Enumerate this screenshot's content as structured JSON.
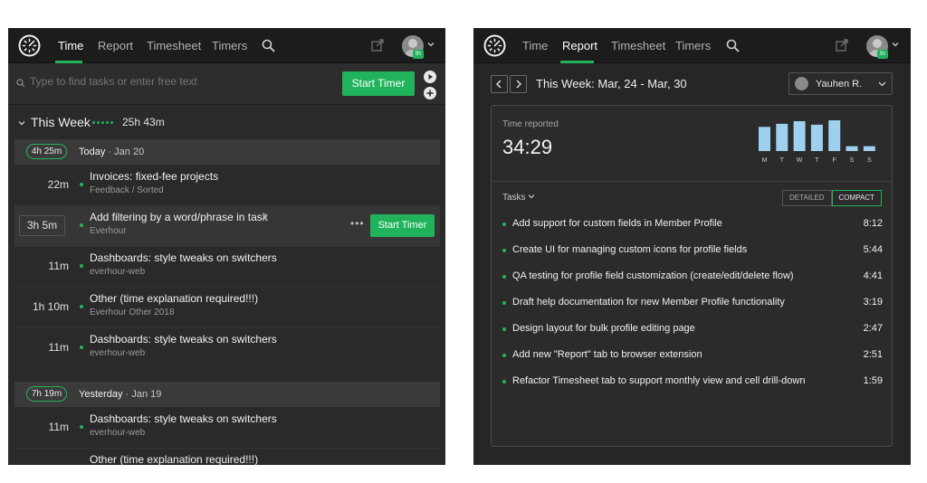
{
  "left": {
    "nav": {
      "tabs": [
        "Time",
        "Report",
        "Timesheet",
        "Timers"
      ],
      "active_tab": "Time",
      "badge": "In"
    },
    "search": {
      "placeholder": "Type to find tasks or enter free text",
      "start_label": "Start Timer"
    },
    "week": {
      "title": "This Week",
      "total": "25h 43m"
    },
    "days": [
      {
        "total": "4h 25m",
        "label": "Today",
        "date": "Jan 20",
        "tasks": [
          {
            "time": "22m",
            "title": "Invoices: fixed-fee projects",
            "project": "Feedback / Sorted"
          },
          {
            "time": "3h 5m",
            "title": "Add filtering by a word/phrase in task",
            "project": "Everhour",
            "start_label": "Start Timer"
          },
          {
            "time": "11m",
            "title": "Dashboards: style tweaks on switchers",
            "project": "everhour-web"
          },
          {
            "time": "1h 10m",
            "title": "Other (time explanation required!!!)",
            "project": "Everhour Other 2018"
          },
          {
            "time": "11m",
            "title": "Dashboards: style tweaks on switchers",
            "project": "everhour-web"
          }
        ]
      },
      {
        "total": "7h 19m",
        "label": "Yesterday",
        "date": "Jan 19",
        "tasks": [
          {
            "time": "11m",
            "title": "Dashboards: style tweaks on switchers",
            "project": "everhour-web"
          },
          {
            "time": "",
            "title": "Other (time explanation required!!!)",
            "project": ""
          }
        ]
      }
    ]
  },
  "right": {
    "nav": {
      "tabs": [
        "Time",
        "Report",
        "Timesheet",
        "Timers"
      ],
      "active_tab": "Report",
      "badge": "In"
    },
    "week_range": "This Week: Mar, 24 - Mar, 30",
    "user": "Yauhen R.",
    "time_reported_label": "Time reported",
    "time_reported_value": "34:29",
    "chart_data": {
      "type": "bar",
      "categories": [
        "M",
        "T",
        "W",
        "T",
        "F",
        "S",
        "S"
      ],
      "values": [
        5.5,
        6.2,
        6.8,
        6.0,
        7.0,
        1.1,
        1.1
      ]
    },
    "tasks_label": "Tasks",
    "view_toggle": [
      "DETAILED",
      "COMPACT"
    ],
    "view_active": "COMPACT",
    "report_rows": [
      {
        "title": "Add support for custom fields in Member Profile",
        "time": "8:12"
      },
      {
        "title": "Create UI for managing custom icons for profile fields",
        "time": "5:44"
      },
      {
        "title": "QA testing for profile field customization (create/edit/delete flow)",
        "time": "4:41"
      },
      {
        "title": "Draft help documentation for new Member Profile functionality",
        "time": "3:19"
      },
      {
        "title": "Design layout for bulk profile editing page",
        "time": "2:47"
      },
      {
        "title": "Add new \"Report\" tab to browser extension",
        "time": "2:51"
      },
      {
        "title": "Refactor Timesheet tab to support monthly view and cell drill-down",
        "time": "1:59"
      }
    ],
    "colors": {
      "accent": "#21b35b",
      "bar": "#9fd0ee"
    }
  }
}
